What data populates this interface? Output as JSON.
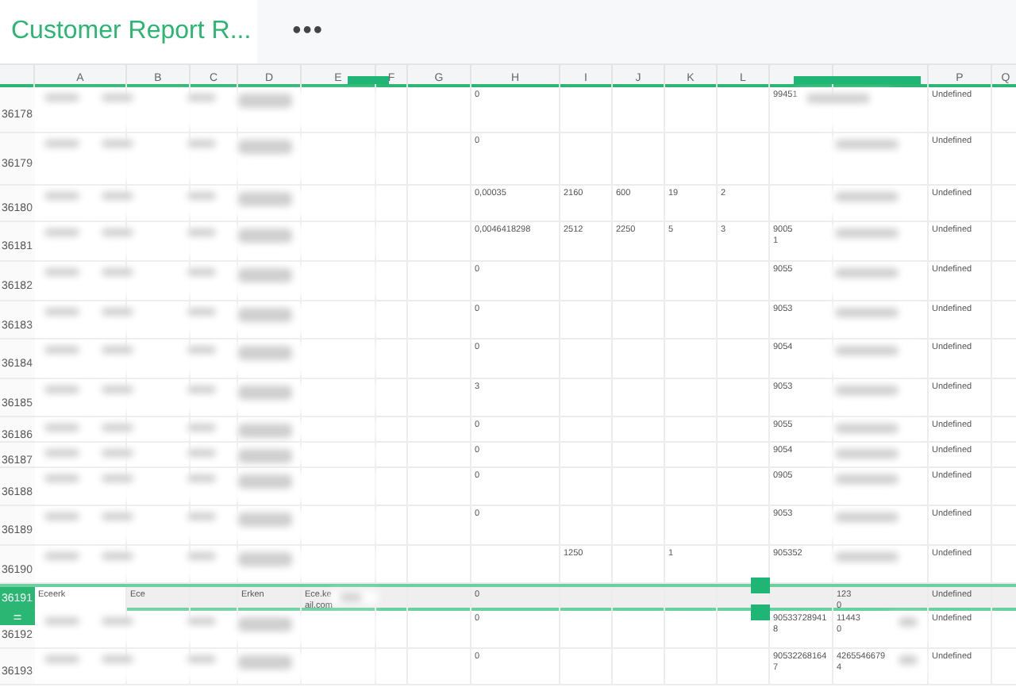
{
  "header": {
    "title": "Customer Report R...",
    "menu": "•••"
  },
  "columns": [
    {
      "label": "A"
    },
    {
      "label": "B"
    },
    {
      "label": "C"
    },
    {
      "label": "D"
    },
    {
      "label": "E"
    },
    {
      "label": "F"
    },
    {
      "label": "G"
    },
    {
      "label": "H"
    },
    {
      "label": "I"
    },
    {
      "label": "J"
    },
    {
      "label": "K"
    },
    {
      "label": "L"
    },
    {},
    {},
    {
      "label": "P"
    },
    {
      "label": "Q"
    }
  ],
  "row_handle": "=",
  "rows": [
    {
      "number": "36178",
      "selected": false,
      "redacted": true,
      "cells": {
        "H": "0",
        "column_13": "99451",
        "P": "Undefined"
      }
    },
    {
      "number": "36179",
      "selected": false,
      "redacted": true,
      "cells": {
        "H": "0",
        "P": "Undefined"
      }
    },
    {
      "number": "36180",
      "selected": false,
      "redacted": true,
      "cells": {
        "H": "0,00035",
        "I": "2160",
        "J": "600",
        "K": "19",
        "L": "2",
        "P": "Undefined"
      }
    },
    {
      "number": "36181",
      "selected": false,
      "redacted": true,
      "cells": {
        "H": "0,0046418298",
        "I": "2512",
        "J": "2250",
        "K": "5",
        "L": "3",
        "column_13": "9005\n1",
        "P": "Undefined"
      }
    },
    {
      "number": "36182",
      "selected": false,
      "redacted": true,
      "cells": {
        "H": "0",
        "column_13": "9055",
        "P": "Undefined"
      }
    },
    {
      "number": "36183",
      "selected": false,
      "redacted": true,
      "cells": {
        "H": "0",
        "column_13": "9053",
        "P": "Undefined"
      }
    },
    {
      "number": "36184",
      "selected": false,
      "redacted": true,
      "cells": {
        "H": "0",
        "column_13": "9054",
        "P": "Undefined"
      }
    },
    {
      "number": "36185",
      "selected": false,
      "redacted": true,
      "cells": {
        "H": "3",
        "column_13": "9053",
        "P": "Undefined"
      }
    },
    {
      "number": "36186",
      "selected": false,
      "redacted": true,
      "cells": {
        "H": "0",
        "column_13": "9055",
        "P": "Undefined"
      }
    },
    {
      "number": "36187",
      "selected": false,
      "redacted": true,
      "cells": {
        "H": "0",
        "column_13": "9054",
        "P": "Undefined"
      }
    },
    {
      "number": "36188",
      "selected": false,
      "redacted": true,
      "cells": {
        "H": "0",
        "column_13": "0905",
        "P": "Undefined"
      }
    },
    {
      "number": "36189",
      "selected": false,
      "redacted": true,
      "cells": {
        "H": "0",
        "column_13": "9053",
        "P": "Undefined"
      }
    },
    {
      "number": "36190",
      "selected": false,
      "redacted": true,
      "cells": {
        "I": "1250",
        "K": "1",
        "column_13": "905352",
        "P": "Undefined"
      }
    },
    {
      "number": "36191",
      "selected": true,
      "redacted": false,
      "cells": {
        "A": "Eceerk",
        "B": "Ece",
        "D": "Erken",
        "E": "Ece.ke\nail.com",
        "H": "0",
        "column_14": "123\n0",
        "P": "Undefined"
      }
    },
    {
      "number": "36192",
      "selected": false,
      "redacted": true,
      "cells": {
        "H": "0",
        "column_13": "905337289418",
        "column_14": "11443\n0",
        "P": "Undefined"
      }
    },
    {
      "number": "36193",
      "selected": false,
      "redacted": true,
      "cells": {
        "H": "0",
        "column_13": "905322681647",
        "column_14": "4265546679\n4",
        "P": "Undefined"
      }
    }
  ]
}
